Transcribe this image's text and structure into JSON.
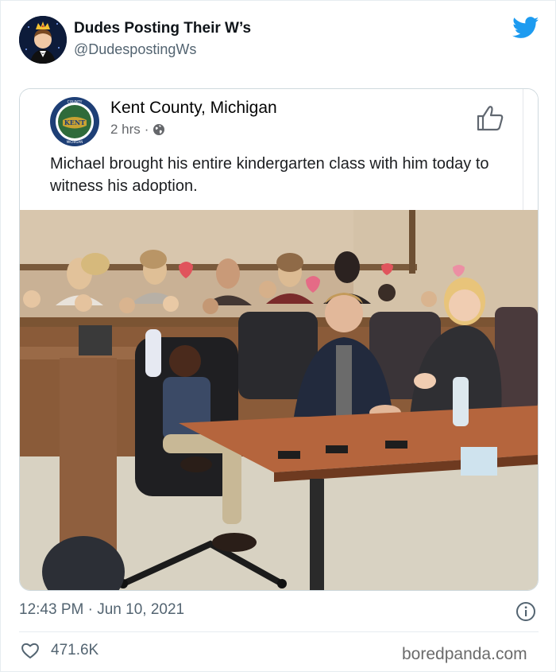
{
  "tweet": {
    "display_name": "Dudes Posting Their W’s",
    "handle": "@DudespostingWs",
    "timestamp": "12:43 PM · Jun 10, 2021",
    "like_count": "471.6K"
  },
  "embedded_post": {
    "page_name": "Kent County, Michigan",
    "time_ago": "2 hrs",
    "separator": "·",
    "text": "Michael brought his entire kindergarten class with him today to witness his adoption.",
    "seal_text_top": "COUNTY",
    "seal_text_center": "KENT",
    "seal_text_bottom": "MICHIGAN"
  },
  "watermark": "boredpanda.com",
  "icons": {
    "avatar": "avatar-image",
    "logo": "twitter-bird-icon",
    "globe": "globe-icon",
    "like": "thumbs-up-icon",
    "info": "info-icon",
    "heart": "heart-icon"
  },
  "colors": {
    "twitter_blue": "#1d9bf0",
    "secondary_text": "#536471",
    "border": "#cfd9de"
  }
}
